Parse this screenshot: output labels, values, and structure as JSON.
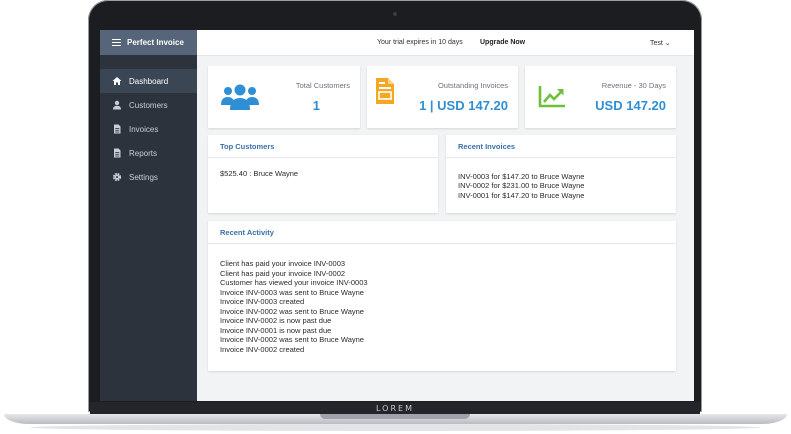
{
  "app": {
    "title": "Perfect Invoice"
  },
  "sidebar": {
    "items": [
      {
        "label": "Dashboard",
        "icon": "home-icon"
      },
      {
        "label": "Customers",
        "icon": "user-icon"
      },
      {
        "label": "Invoices",
        "icon": "document-icon"
      },
      {
        "label": "Reports",
        "icon": "document-icon"
      },
      {
        "label": "Settings",
        "icon": "gear-icon"
      }
    ]
  },
  "topbar": {
    "trial_text": "Your trial expires in 10 days",
    "upgrade_label": "Upgrade Now",
    "user_label": "Test  ⌄"
  },
  "stats": [
    {
      "label": "Total Customers",
      "value": "1",
      "icon": "users-icon",
      "color": "#2f8fd4"
    },
    {
      "label": "Outstanding Invoices",
      "value": "1 | USD 147.20",
      "icon": "invoice-icon",
      "color": "#f5a623"
    },
    {
      "label": "Revenue - 30 Days",
      "value": "USD 147.20",
      "icon": "trend-up-icon",
      "color": "#6fbf3b"
    }
  ],
  "top_customers": {
    "title": "Top Customers",
    "items": [
      "$525.40 : Bruce Wayne"
    ]
  },
  "recent_invoices": {
    "title": "Recent Invoices",
    "items": [
      "INV-0003 for $147.20 to Bruce Wayne",
      "INV-0002 for $231.00 to Bruce Wayne",
      "INV-0001 for $147.20 to Bruce Wayne"
    ]
  },
  "recent_activity": {
    "title": "Recent Activity",
    "items": [
      "Client has paid your invoice INV-0003",
      "Client has paid your invoice INV-0002",
      "Customer has viewed your invoice INV-0003",
      "Invoice INV-0003 was sent to Bruce Wayne",
      "Invoice INV-0003 created",
      "Invoice INV-0002 was sent to Bruce Wayne",
      "Invoice INV-0002 is now past due",
      "Invoice INV-0001 is now past due",
      "Invoice INV-0002 was sent to Bruce Wayne",
      "Invoice INV-0002 created"
    ]
  },
  "laptop": {
    "brand": "LOREM"
  }
}
